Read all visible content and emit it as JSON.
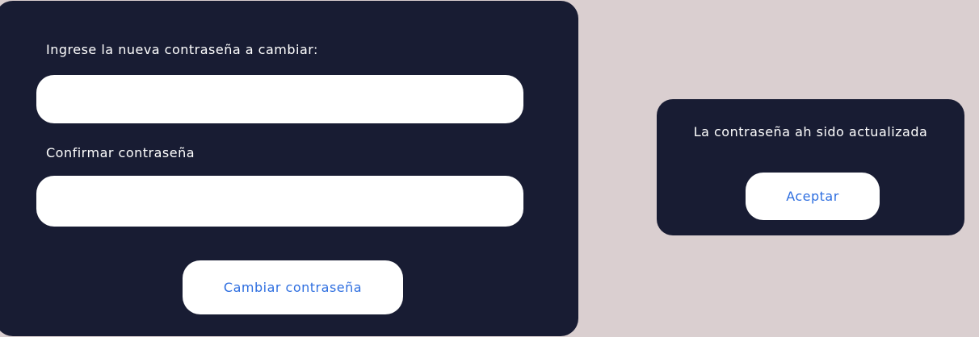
{
  "password_form": {
    "new_password_label": "Ingrese la nueva contraseña a cambiar:",
    "new_password_value": "",
    "confirm_password_label": "Confirmar contraseña",
    "confirm_password_value": "",
    "submit_label": "Cambiar contraseña"
  },
  "confirmation_dialog": {
    "message": "La contraseña ah sido actualizada",
    "accept_label": "Aceptar"
  },
  "colors": {
    "background": "#dacfd0",
    "panel": "#181c33",
    "field": "#ffffff",
    "button_text": "#2f6fe0"
  }
}
